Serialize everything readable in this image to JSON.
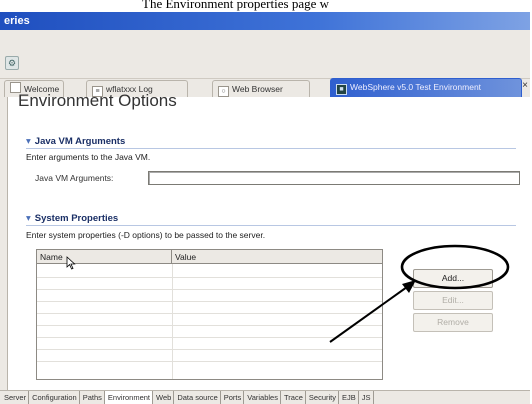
{
  "caption": "The Environment properties page w",
  "window": {
    "title": "eries"
  },
  "tabs": [
    {
      "label": "Welcome"
    },
    {
      "label": "wflatxxx Log"
    },
    {
      "label": "Web Browser"
    },
    {
      "label": "WebSphere v5.0 Test Environment"
    }
  ],
  "page": {
    "title": "Environment Options"
  },
  "jvm": {
    "heading": "Java VM Arguments",
    "description": "Enter arguments to the Java VM.",
    "field_label": "Java VM Arguments:",
    "value": ""
  },
  "system_properties": {
    "heading": "System Properties",
    "description": "Enter system properties (-D options) to be passed to the server.",
    "columns": [
      "Name",
      "Value"
    ],
    "rows": []
  },
  "buttons": {
    "add": "Add...",
    "edit": "Edit...",
    "remove": "Remove"
  },
  "bottom_tabs": [
    "Server",
    "Configuration",
    "Paths",
    "Environment",
    "Web",
    "Data source",
    "Ports",
    "Variables",
    "Trace",
    "Security",
    "EJB",
    "JS"
  ],
  "active_bottom_tab": "Environment",
  "colors": {
    "title_bar": "#1f4fbf",
    "active_tab": "#2f5fcf",
    "section_heading": "#1a2f66",
    "callout": "#000000"
  }
}
